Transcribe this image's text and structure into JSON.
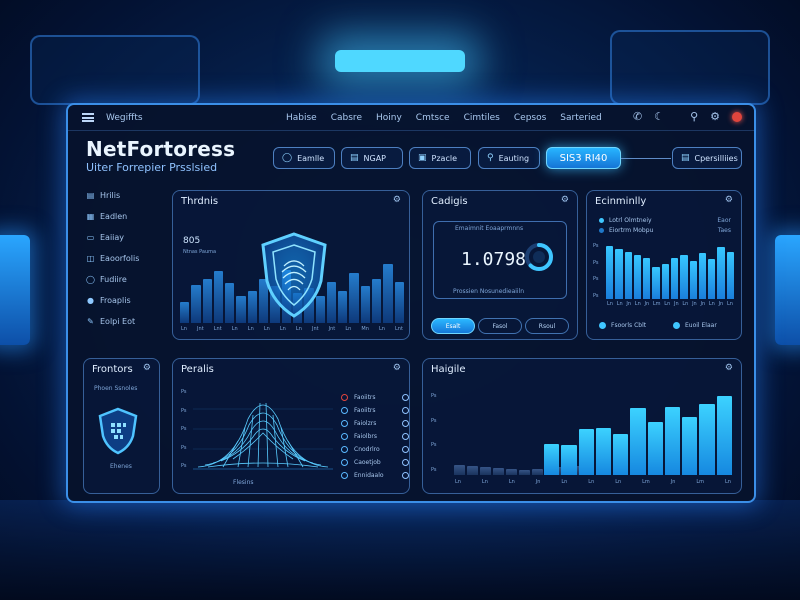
{
  "app": {
    "name": "Wegiffts"
  },
  "nav": [
    "Habise",
    "Cabsre",
    "Hoiny",
    "Cmtsce",
    "Cimtiles",
    "Cepsos",
    "Sarteried"
  ],
  "brand": {
    "title": "NetFortoress",
    "subtitle": "Uiter Forrepier Prsslsied"
  },
  "header_buttons": {
    "b1": "Eamlle",
    "b2": "NGAP",
    "b3": "Pzacle",
    "b4": "Eauting",
    "active": "SIS3 RI40",
    "right": "Cpersilliies"
  },
  "sidebar": [
    {
      "label": "Hrilis",
      "icon": "chart-icon"
    },
    {
      "label": "Eadlen",
      "icon": "grid-icon"
    },
    {
      "label": "Eaiiay",
      "icon": "doc-icon"
    },
    {
      "label": "Eaoorfolis",
      "icon": "folder-icon"
    },
    {
      "label": "Fudiire",
      "icon": "shield-icon"
    },
    {
      "label": "Froaplis",
      "icon": "user-icon"
    },
    {
      "label": "Eolpi Eot",
      "icon": "pen-icon"
    }
  ],
  "card_threats": {
    "title": "Thrdnis",
    "label1": "805",
    "label2": "Ntnas Pauma",
    "values": [
      14,
      26,
      30,
      35,
      27,
      18,
      22,
      30,
      25,
      36,
      20,
      24,
      18,
      28,
      22,
      34,
      25,
      30,
      40,
      28
    ],
    "xticks": [
      "Ln",
      "Jnt",
      "Lnt",
      "Ln",
      "Ln",
      "Ln",
      "Ln",
      "Ln",
      "Jnt",
      "Jnt",
      "Ln",
      "Mn",
      "Ln",
      "Lnt"
    ]
  },
  "card_cadigis": {
    "title": "Cadigis",
    "sub": "Emaimnit Eoaaprmnns",
    "value": "1.0798",
    "ring_pct": 0.62,
    "note": "Prossien Nosunedieaiiln",
    "seg": [
      "Esalt",
      "Fasol",
      "Rsoul"
    ],
    "seg_active": 0
  },
  "card_community": {
    "title": "Ecinminlly",
    "leg1": "Lotrl Olmtneiy",
    "leg2": "Eiortrm Mobpu",
    "right1": "Eaor",
    "right2": "Taes",
    "values": [
      36,
      34,
      32,
      30,
      28,
      22,
      24,
      28,
      30,
      26,
      31,
      27,
      35,
      32
    ],
    "yticks": [
      "Ps",
      "Ps",
      "Ps",
      "Ps"
    ],
    "xticks": [
      "Ln",
      "Ln",
      "Jn",
      "Ln",
      "Jn",
      "Lm",
      "Ln",
      "Jn",
      "Ln",
      "Jn",
      "Jn",
      "Ln",
      "Jn",
      "Ln"
    ],
    "foot1": "Fsoorls Cblt",
    "foot2": "Euoil Elaar"
  },
  "card_fronttors": {
    "title": "Frontors",
    "sub": "Phoen Ssnoles",
    "foot": "Ehenes"
  },
  "card_peralis": {
    "title": "Peralis",
    "yticks": [
      "Ps",
      "Ps",
      "Ps",
      "Ps",
      "Ps"
    ],
    "xlabel": "Flesins",
    "list": [
      "Faoiitrs",
      "Faoiitrs",
      "Faiolzrs",
      "Faiolbrs",
      "Cnodrlro",
      "Caoetjob",
      "Ennidaalo"
    ]
  },
  "card_haigile": {
    "title": "Haigile",
    "yticks": [
      "Ps",
      "Ps",
      "Ps",
      "Ps"
    ],
    "values_dark": [
      10,
      9,
      8,
      7,
      6,
      5,
      6,
      7,
      8,
      9
    ],
    "values": [
      32,
      31,
      48,
      49,
      43,
      69,
      55,
      70,
      60,
      74,
      82
    ],
    "xticks": [
      "Ln",
      "Ln",
      "Ln",
      "Jn",
      "Ln",
      "Ln",
      "Ln",
      "Lm",
      "Jn",
      "Lm",
      "Ln"
    ]
  },
  "colors": {
    "accent": "#2bb8ff",
    "bar": "#1f9ce8",
    "bar_light": "#35c8ff",
    "alert": "#e0453d"
  }
}
